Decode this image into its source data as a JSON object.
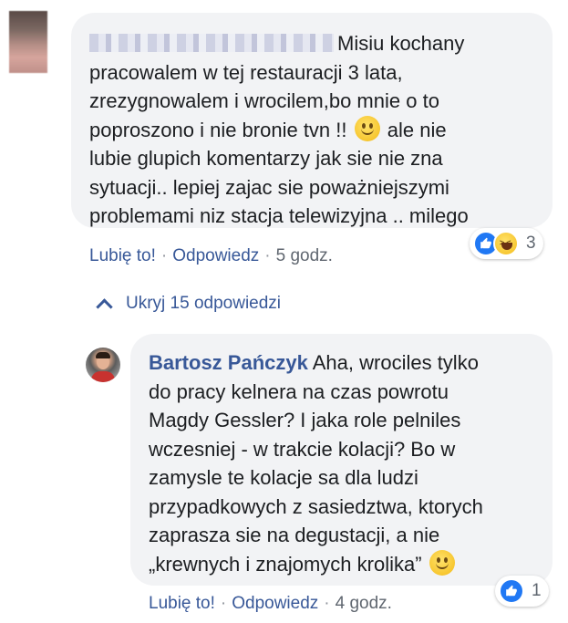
{
  "comment_1": {
    "text": "Misiu kochany\npracowalem w tej restauracji 3 lata,\nzrezygnowalem i wrocilem,bo mnie o to\npoproszono i nie bronie tvn !! ",
    "text_after_emoji": " ale nie\nlubie glupich komentarzy jak sie nie zna\nsytuacji.. lepiej zajac sie poważniejszymi\nproblemami niz stacja telewizyjna .. milego",
    "like_label": "Lubię to!",
    "reply_label": "Odpowiedz",
    "time": "5 godz.",
    "reaction_count": "3",
    "reactions": [
      "like-icon",
      "haha-icon"
    ]
  },
  "hide_replies_label": "Ukryj 15 odpowiedzi",
  "comment_2": {
    "author": "Bartosz Pańczyk",
    "text": " Aha, wrociles tylko\ndo pracy kelnera na czas powrotu\nMagdy Gessler? I jaka role pelniles\nwczesniej - w trakcie kolacji? Bo w\nzamysle te kolacje sa dla ludzi\nprzypadkowych z sasiedztwa, ktorych\nzaprasza sie na degustacji, a nie\n„krewnych i znajomych krolika” ",
    "like_label": "Lubię to!",
    "reply_label": "Odpowiedz",
    "time": "4 godz.",
    "reaction_count": "1",
    "reactions": [
      "like-icon"
    ]
  },
  "colors": {
    "link": "#385898",
    "bubble": "#f2f3f5",
    "like_blue": "#2078f4",
    "meta_gray": "#606770"
  }
}
